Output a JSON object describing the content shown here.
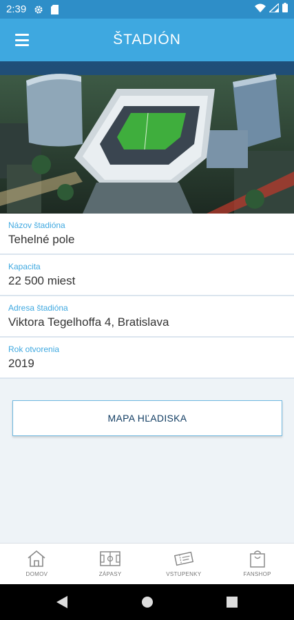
{
  "status_bar": {
    "time": "2:39",
    "icons": [
      "settings-icon",
      "sim-card-icon",
      "wifi-icon",
      "signal-icon",
      "battery-icon"
    ]
  },
  "app_bar": {
    "title": "ŠTADIÓN",
    "menu_icon": "hamburger-menu-icon"
  },
  "hero": {
    "image": "stadium-aerial-night-render"
  },
  "info": {
    "rows": [
      {
        "label": "Názov štadióna",
        "value": "Tehelné pole"
      },
      {
        "label": "Kapacita",
        "value": "22 500 miest"
      },
      {
        "label": "Adresa štadióna",
        "value": "Viktora Tegelhoffa 4, Bratislava"
      },
      {
        "label": "Rok otvorenia",
        "value": "2019"
      }
    ]
  },
  "map_button": {
    "label": "MAPA HĽADISKA"
  },
  "bottom_nav": {
    "items": [
      {
        "label": "DOMOV",
        "icon": "home-icon"
      },
      {
        "label": "ZÁPASY",
        "icon": "pitch-icon"
      },
      {
        "label": "VSTUPENKY",
        "icon": "tickets-icon"
      },
      {
        "label": "FANSHOP",
        "icon": "shopping-bag-icon"
      }
    ]
  },
  "system_nav": {
    "icons": [
      "back-icon",
      "home-circle-icon",
      "recents-icon"
    ]
  },
  "colors": {
    "primary": "#3ea8e0",
    "status_bar": "#2e8ec8",
    "label": "#3ea8e0",
    "button_text": "#123d63",
    "background": "#eef3f7"
  }
}
